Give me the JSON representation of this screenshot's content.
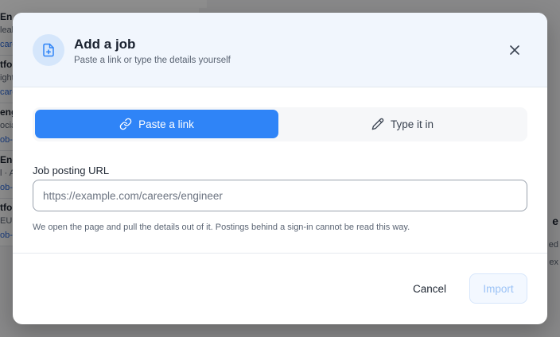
{
  "background": {
    "cards": [
      {
        "title": "En",
        "sub": "leal",
        "link": "care"
      },
      {
        "title": "tfo",
        "sub": "ight",
        "link": "care"
      },
      {
        "title": "eng",
        "sub": "ocia",
        "link": "ob-"
      },
      {
        "title": "Eng",
        "sub": "l · A",
        "link": "ob-"
      },
      {
        "title": "tfo",
        "sub": "EU",
        "link": "ob-"
      }
    ],
    "right_title": "e",
    "right_line1": "ed",
    "right_line2": "ex"
  },
  "modal": {
    "title": "Add a job",
    "subtitle": "Paste a link or type the details yourself",
    "header_icon": "file-plus-icon",
    "close_icon": "close-icon",
    "tabs": [
      {
        "label": "Paste a link",
        "icon": "link-icon",
        "active": true
      },
      {
        "label": "Type it in",
        "icon": "pencil-icon",
        "active": false
      }
    ],
    "field": {
      "label": "Job posting URL",
      "value": "",
      "placeholder": "https://example.com/careers/engineer"
    },
    "help_text": "We open the page and pull the details out of it. Postings behind a sign-in cannot be read this way.",
    "cancel_label": "Cancel",
    "import_label": "Import"
  },
  "colors": {
    "accent": "#2f84f7",
    "header_bg": "#f1f6fd",
    "import_disabled_text": "#9cc3f6"
  }
}
